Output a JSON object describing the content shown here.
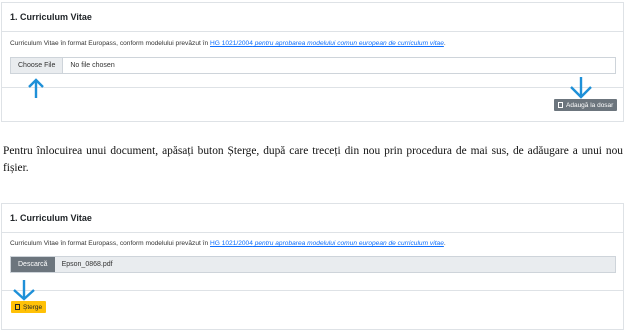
{
  "section1": {
    "title": "1. Curriculum Vitae",
    "description_prefix": "Curriculum Vitae în format Europass, conform modelului prevăzut în ",
    "link_code": "HG 1021/2004",
    "link_italic": " pentru aprobarea modelului comun european de curriculum vitae",
    "description_suffix": ".",
    "choose_file_label": "Choose File",
    "file_status": "No file chosen",
    "add_button_label": "Adaugă la dosar"
  },
  "instruction": "Pentru înlocuirea unui document, apăsați buton Șterge, după care treceți din nou prin procedura de mai sus, de adăugare a unui nou fișier.",
  "section2": {
    "title": "1. Curriculum Vitae",
    "description_prefix": "Curriculum Vitae în format Europass, conform modelului prevăzut în ",
    "link_code": "HG 1021/2004",
    "link_italic": " pentru aprobarea modelului comun european de curriculum vitae",
    "description_suffix": ".",
    "download_label": "Descarcă",
    "file_name": "Epson_0868.pdf",
    "delete_button_label": "Șterge"
  },
  "colors": {
    "arrow": "#1e90d8",
    "delete_button": "#ffc107",
    "secondary_button": "#6c757d",
    "link": "#0d6efd"
  }
}
